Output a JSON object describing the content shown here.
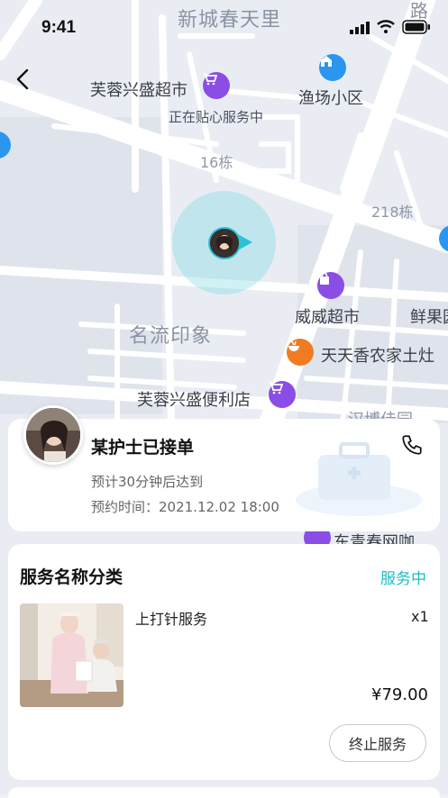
{
  "status_bar": {
    "time": "9:41"
  },
  "map": {
    "labels": {
      "xincheng": "新城春天里",
      "furong_super": "芙蓉兴盛超市",
      "tiexin": "正在贴心服务中",
      "yuchang": "渔场小区",
      "b16": "16栋",
      "b218": "218栋",
      "mingliu": "名流印象",
      "weiwei": "威威超市",
      "xianguo": "鲜果园",
      "tiantian": "天天香农家土灶",
      "furong_conv": "芙蓉兴盛便利店",
      "hanbo": "汉博佳园",
      "dongqing": "东青春网咖",
      "road": "路"
    }
  },
  "nurse": {
    "title": "某护士已接单",
    "eta": "预计30分钟后达到",
    "appointment": "预约时间：2021.12.02 18:00"
  },
  "service": {
    "section_title": "服务名称分类",
    "status": "服务中",
    "item_name": "上打针服务",
    "quantity": "x1",
    "price": "¥79.00",
    "terminate_label": "终止服务"
  },
  "colors": {
    "accent": "#1bbcc8",
    "poi_purple": "#8a4ee6",
    "poi_blue": "#2a96f0",
    "poi_orange": "#f07b22"
  }
}
